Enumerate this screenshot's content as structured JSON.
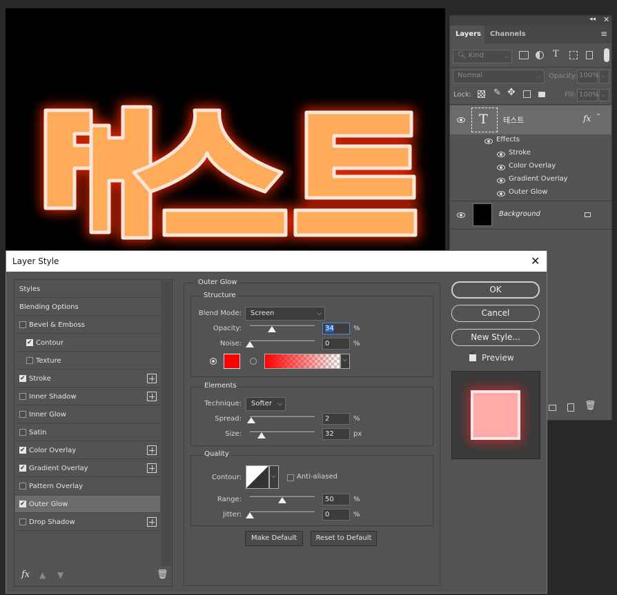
{
  "canvas": {
    "text": "테스트",
    "fill_color": "#ffab5a",
    "stroke_color": "#f5e6dc",
    "glow_color": "#ff2a00"
  },
  "layers_panel": {
    "tabs": [
      "Layers",
      "Channels"
    ],
    "filter_kind": "Kind",
    "blend_mode": "Normal",
    "opacity_label": "Opacity:",
    "opacity_value": "100%",
    "lock_label": "Lock:",
    "fill_label": "Fill:",
    "fill_value": "100%",
    "layers": [
      {
        "name": "테스트",
        "type": "text",
        "thumb_glyph": "T",
        "fx": "fx",
        "effects_label": "Effects",
        "effects": [
          "Stroke",
          "Color Overlay",
          "Gradient Overlay",
          "Outer Glow"
        ]
      },
      {
        "name": "Background",
        "type": "fill",
        "locked": true
      }
    ]
  },
  "dialog": {
    "title": "Layer Style",
    "styles": [
      {
        "label": "Styles",
        "checkbox": false
      },
      {
        "label": "Blending Options",
        "checkbox": false
      },
      {
        "label": "Bevel & Emboss",
        "checkbox": true,
        "checked": false
      },
      {
        "label": "Contour",
        "checkbox": true,
        "checked": true,
        "indent": true
      },
      {
        "label": "Texture",
        "checkbox": true,
        "checked": false,
        "indent": true
      },
      {
        "label": "Stroke",
        "checkbox": true,
        "checked": true,
        "plus": true
      },
      {
        "label": "Inner Shadow",
        "checkbox": true,
        "checked": false,
        "plus": true
      },
      {
        "label": "Inner Glow",
        "checkbox": true,
        "checked": false
      },
      {
        "label": "Satin",
        "checkbox": true,
        "checked": false
      },
      {
        "label": "Color Overlay",
        "checkbox": true,
        "checked": true,
        "plus": true
      },
      {
        "label": "Gradient Overlay",
        "checkbox": true,
        "checked": true,
        "plus": true
      },
      {
        "label": "Pattern Overlay",
        "checkbox": true,
        "checked": false
      },
      {
        "label": "Outer Glow",
        "checkbox": true,
        "checked": true,
        "selected": true
      },
      {
        "label": "Drop Shadow",
        "checkbox": true,
        "checked": false,
        "plus": true
      }
    ],
    "footer_fx": "fx",
    "section_title": "Outer Glow",
    "structure": {
      "title": "Structure",
      "blend_mode_label": "Blend Mode:",
      "blend_mode": "Screen",
      "opacity_label": "Opacity:",
      "opacity": "34",
      "opacity_level": 0.34,
      "noise_label": "Noise:",
      "noise": "0",
      "noise_level": 0.0,
      "unit": "%",
      "glow_color": "#ff0000"
    },
    "elements": {
      "title": "Elements",
      "technique_label": "Technique:",
      "technique": "Softer",
      "spread_label": "Spread:",
      "spread": "2",
      "spread_level": 0.02,
      "spread_unit": "%",
      "size_label": "Size:",
      "size": "32",
      "size_unit": "px"
    },
    "quality": {
      "title": "Quality",
      "contour_label": "Contour:",
      "anti_aliased_label": "Anti-aliased",
      "anti_aliased": false,
      "range_label": "Range:",
      "range": "50",
      "range_level": 0.5,
      "jitter_label": "Jitter:",
      "jitter": "0",
      "jitter_level": 0.0,
      "unit": "%"
    },
    "make_default": "Make Default",
    "reset_default": "Reset to Default",
    "ok": "OK",
    "cancel": "Cancel",
    "new_style": "New Style...",
    "preview_label": "Preview",
    "preview_checked": true,
    "preview_swatch_color": "#ffa9a9"
  }
}
